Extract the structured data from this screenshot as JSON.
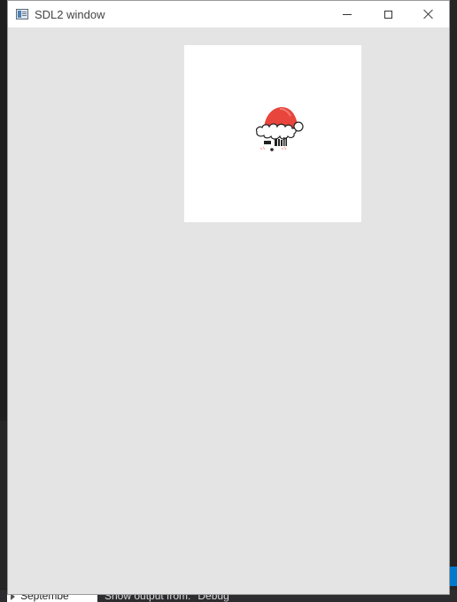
{
  "window": {
    "title": "SDL2 window",
    "icon": "window-app-icon",
    "caption_buttons": [
      "minimize-icon",
      "maximize-icon",
      "close-icon"
    ]
  },
  "canvas": {
    "background_color": "#e4e4e4",
    "panel_color": "#ffffff",
    "sprite": "santa-hat-icon"
  },
  "background": {
    "tree_item_label": "Septembe",
    "output_label": "Show output from:",
    "output_source": "Debug"
  },
  "colors": {
    "hat_red": "#e8453c",
    "accent_blue": "#007acc"
  }
}
